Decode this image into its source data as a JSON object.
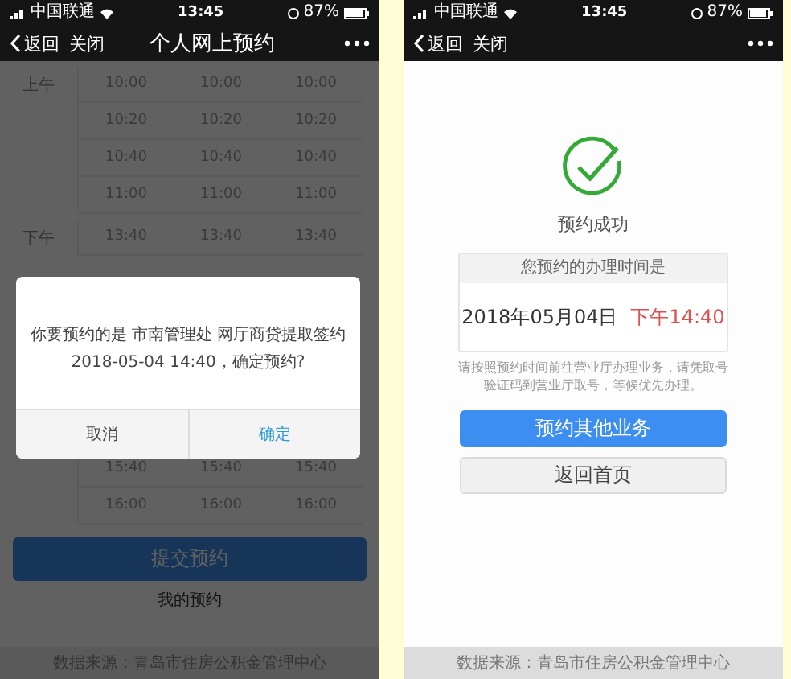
{
  "left_screen": {
    "status_bar": {
      "carrier": "中国联通",
      "time": "13:45",
      "battery": "87%"
    },
    "nav": {
      "back": "返回",
      "close": "关闭",
      "title": "个人网上预约"
    },
    "schedule": [
      {
        "label": "上午",
        "rows": [
          [
            "10:00",
            "10:00",
            "10:00"
          ],
          [
            "10:20",
            "10:20",
            "10:20"
          ],
          [
            "10:40",
            "10:40",
            "10:40"
          ],
          [
            "11:00",
            "11:00",
            "11:00"
          ]
        ]
      },
      {
        "label": "下午",
        "rows": [
          [
            "13:40",
            "13:40",
            "13:40"
          ]
        ]
      },
      {
        "rows": [
          [
            "15:40",
            "15:40",
            "15:40"
          ],
          [
            "16:00",
            "16:00",
            "16:00"
          ]
        ]
      }
    ],
    "submit_button": "提交预约",
    "my_link": "我的预约",
    "footer": "数据来源：青岛市住房公积金管理中心",
    "dialog": {
      "message_lines": [
        "你要预约的是 市南管理处 网厅商贷提取签约",
        "2018-05-04 14:40，确定预约?"
      ],
      "buttons": [
        {
          "label": "取消",
          "kind": "cancel"
        },
        {
          "label": "确定",
          "kind": "confirm"
        }
      ]
    }
  },
  "right_screen": {
    "status_bar": {
      "carrier": "中国联通",
      "time": "13:45",
      "battery": "87%"
    },
    "nav": {
      "back": "返回",
      "close": "关闭"
    },
    "result": "预约成功",
    "card": {
      "heading": "您预约的办理时间是",
      "date": "2018年05月04日",
      "time": "下午14:40"
    },
    "note": "请按照预约时间前往营业厅办理业务，请凭取号验证码到营业厅取号，等候优先办理。",
    "buttons": [
      {
        "label": "预约其他业务",
        "kind": "primary"
      },
      {
        "label": "返回首页",
        "kind": "secondary"
      }
    ],
    "footer": "数据来源：青岛市住房公积金管理中心"
  }
}
